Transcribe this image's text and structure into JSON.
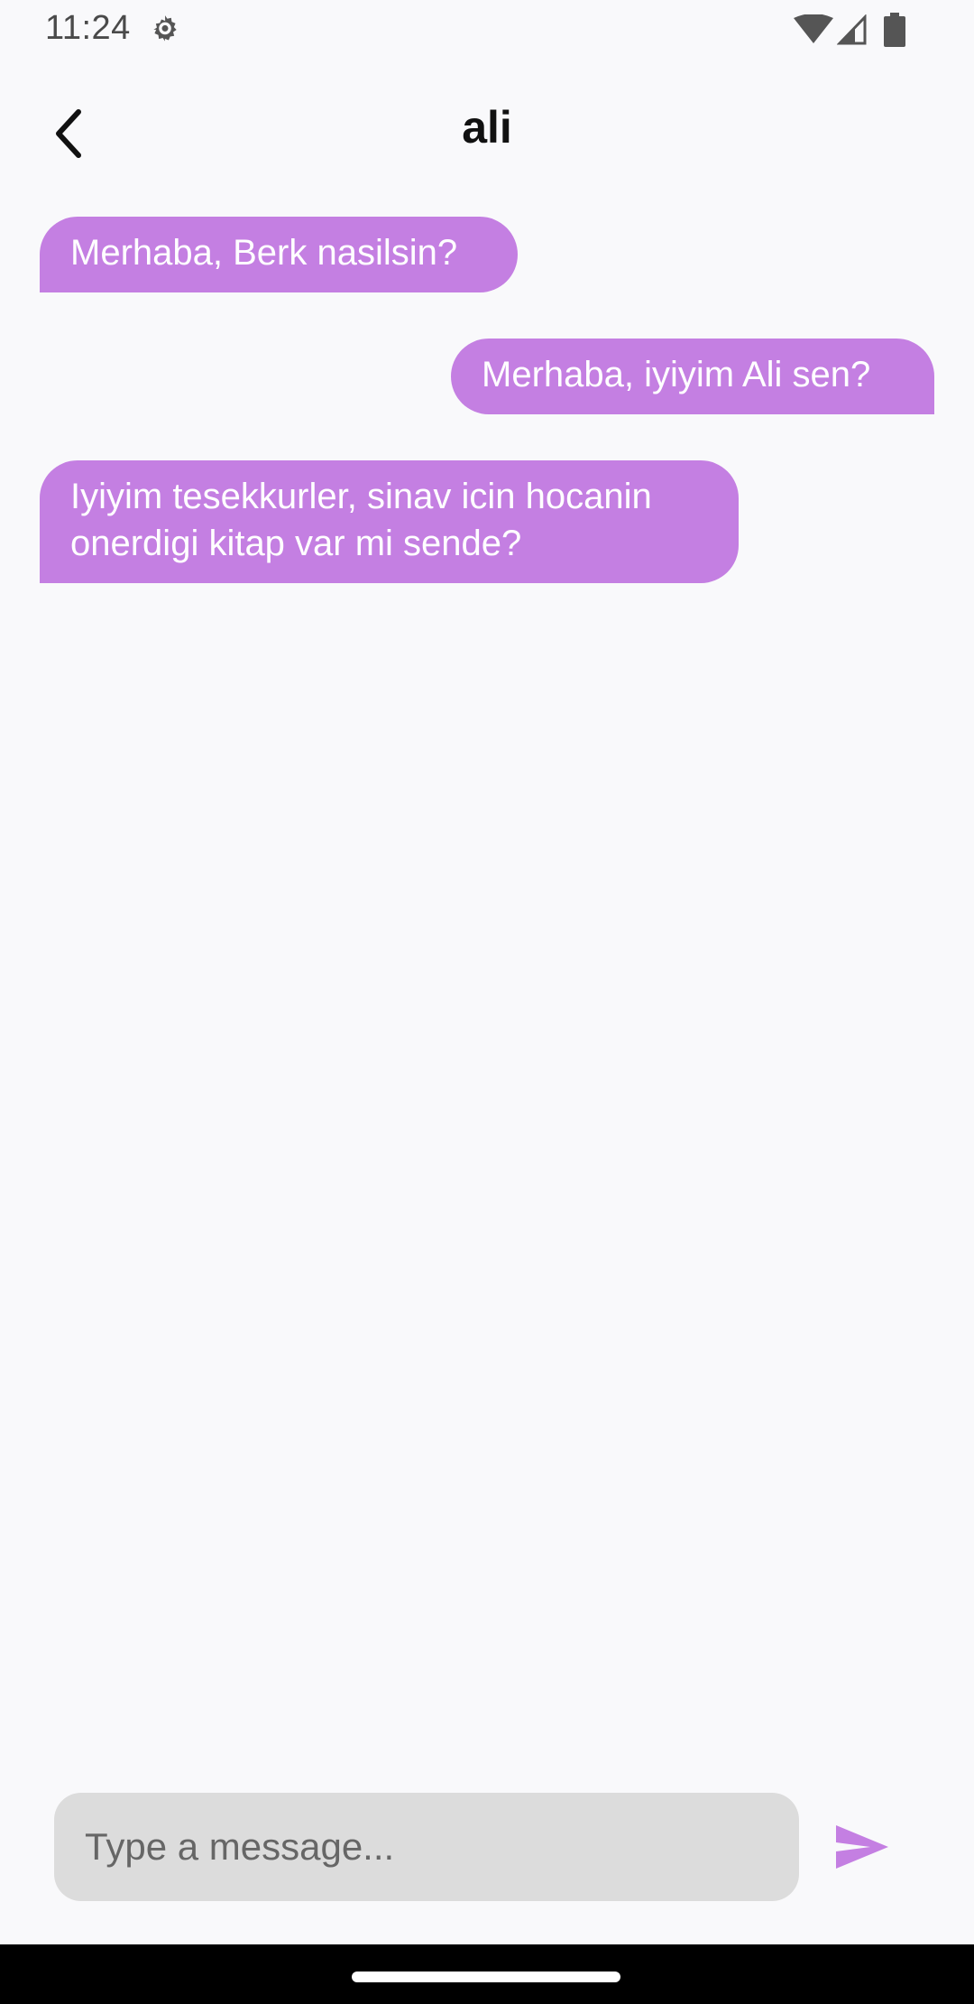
{
  "status_bar": {
    "time": "11:24",
    "icons": [
      "gear-icon",
      "wifi-icon",
      "signal-icon",
      "battery-icon"
    ]
  },
  "app_bar": {
    "title": "ali",
    "back_icon": "chevron-left-icon"
  },
  "messages": [
    {
      "direction": "incoming",
      "text": "Merhaba, Berk nasilsin?"
    },
    {
      "direction": "outgoing",
      "text": "Merhaba, iyiyim Ali sen?"
    },
    {
      "direction": "incoming",
      "text": "Iyiyim tesekkurler, sinav icin hocanin onerdigi kitap var mi sende?"
    }
  ],
  "composer": {
    "value": "",
    "placeholder": "Type a message...",
    "send_icon": "send-icon"
  },
  "colors": {
    "bubble": "#c47fe2",
    "accent": "#c47fe2",
    "input_background": "#dcdcdc",
    "background": "#f9f9fb"
  }
}
